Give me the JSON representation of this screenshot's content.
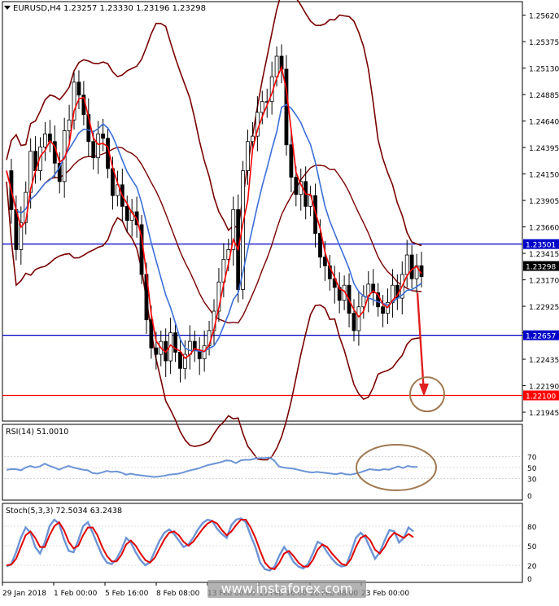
{
  "header": {
    "symbol_tf": "EURUSD,H4",
    "ohlc": "1.23257 1.23330 1.23196 1.23298"
  },
  "watermark": "www.instaforex.com",
  "colors": {
    "candle": "#000000",
    "bollinger": "#7a0000",
    "ma_fast": "#ff0000",
    "ma_slow": "#3a6fd8",
    "hline_blue": "#0000c8",
    "hline_red": "#ff0000",
    "rsi": "#6c94d6",
    "stoch_main": "#6c94d6",
    "stoch_signal": "#e00000",
    "annotation": "#a07850",
    "arrow": "#e02020"
  },
  "chart_data": [
    {
      "type": "candlestick",
      "symbol": "EURUSD",
      "timeframe": "H4",
      "y_ticks": [
        "1.25620",
        "1.25375",
        "1.25130",
        "1.24885",
        "1.24640",
        "1.24395",
        "1.24150",
        "1.23905",
        "1.23660",
        "1.23415",
        "1.23170",
        "1.22925",
        "1.22680",
        "1.22435",
        "1.22190",
        "1.21945"
      ],
      "ylim": [
        1.219,
        1.257
      ],
      "x_tick_labels": [
        "29 Jan 2018",
        "1 Feb 00:00",
        "5 Feb 16:00",
        "8 Feb 08:00",
        "13 Feb 00:00",
        "15 Feb 16:00",
        "20 Feb 08:00",
        "23 Feb 00:00"
      ],
      "horizontal_levels": [
        {
          "value": 1.23501,
          "label": "1.23501",
          "color": "blue"
        },
        {
          "value": 1.22657,
          "label": "1.22657",
          "color": "blue"
        },
        {
          "value": 1.221,
          "label": "1.22100",
          "color": "red"
        }
      ],
      "current_price": {
        "value": 1.23298,
        "label": "1.23298"
      },
      "price_path": [
        1.2418,
        1.2382,
        1.2345,
        1.237,
        1.2398,
        1.2436,
        1.2418,
        1.244,
        1.2452,
        1.2445,
        1.2425,
        1.2408,
        1.2455,
        1.2465,
        1.25,
        1.2488,
        1.247,
        1.2445,
        1.243,
        1.2452,
        1.2448,
        1.242,
        1.2395,
        1.2405,
        1.2385,
        1.2372,
        1.238,
        1.2368,
        1.2322,
        1.228,
        1.2254,
        1.2248,
        1.226,
        1.2242,
        1.2268,
        1.225,
        1.2235,
        1.2248,
        1.226,
        1.2252,
        1.2244,
        1.2256,
        1.227,
        1.2288,
        1.2315,
        1.2336,
        1.2345,
        1.2382,
        1.2308,
        1.2418,
        1.2445,
        1.245,
        1.2472,
        1.2482,
        1.2482,
        1.2505,
        1.2524,
        1.2512,
        1.2442,
        1.2412,
        1.2396,
        1.2408,
        1.2385,
        1.2395,
        1.236,
        1.2338,
        1.233,
        1.2318,
        1.231,
        1.2298,
        1.2312,
        1.2286,
        1.227,
        1.2292,
        1.2302,
        1.2313,
        1.2305,
        1.2292,
        1.2286,
        1.2296,
        1.2312,
        1.23,
        1.2322,
        1.234,
        1.2318,
        1.233,
        1.232
      ],
      "forecast_arrow": {
        "from": 1.2305,
        "to": 1.2212
      }
    },
    {
      "type": "line",
      "title": "RSI(14) 51.0010",
      "y_ticks": [
        "70",
        "50",
        "30",
        "0"
      ],
      "ylim": [
        0,
        100
      ],
      "levels": [
        70,
        50,
        30
      ],
      "values": [
        46,
        47,
        47,
        45,
        50,
        53,
        50,
        52,
        57,
        53,
        50,
        46,
        50,
        53,
        50,
        48,
        46,
        45,
        40,
        39,
        41,
        44,
        42,
        43,
        41,
        37,
        39,
        37,
        36,
        35,
        34,
        33,
        34,
        35,
        37,
        38,
        39,
        41,
        44,
        46,
        48,
        51,
        54,
        56,
        58,
        60,
        63,
        62,
        58,
        63,
        64,
        64,
        66,
        67,
        67,
        68,
        63,
        52,
        50,
        49,
        48,
        46,
        44,
        42,
        41,
        42,
        41,
        40,
        39,
        38,
        40,
        38,
        37,
        39,
        41,
        44,
        47,
        46,
        45,
        47,
        46,
        49,
        52,
        49,
        53,
        51,
        51
      ]
    },
    {
      "type": "line",
      "title": "Stoch(5,3,3) 72.5034 63.2438",
      "y_ticks": [
        "80",
        "50",
        "20",
        "0"
      ],
      "ylim": [
        0,
        100
      ],
      "levels": [
        80,
        50,
        20
      ],
      "series": [
        {
          "values": [
            18,
            22,
            40,
            62,
            78,
            70,
            48,
            38,
            55,
            80,
            90,
            84,
            60,
            42,
            40,
            58,
            80,
            86,
            70,
            52,
            35,
            24,
            22,
            30,
            44,
            62,
            55,
            40,
            28,
            20,
            25,
            42,
            58,
            70,
            75,
            68,
            58,
            48,
            52,
            62,
            75,
            85,
            90,
            88,
            76,
            68,
            62,
            82,
            90,
            92,
            86,
            66,
            48,
            24,
            14,
            12,
            18,
            35,
            48,
            38,
            25,
            18,
            15,
            22,
            38,
            56,
            52,
            40,
            30,
            22,
            18,
            20,
            40,
            62,
            70,
            62,
            46,
            30,
            40,
            58,
            74,
            72,
            55,
            62,
            78,
            72
          ]
        },
        {
          "values": [
            20,
            21,
            30,
            48,
            66,
            72,
            62,
            48,
            48,
            66,
            80,
            86,
            74,
            56,
            46,
            50,
            66,
            78,
            78,
            66,
            48,
            34,
            26,
            26,
            36,
            52,
            58,
            50,
            38,
            28,
            24,
            32,
            46,
            60,
            70,
            72,
            66,
            56,
            50,
            56,
            66,
            76,
            84,
            88,
            84,
            74,
            66,
            72,
            82,
            90,
            90,
            78,
            62,
            42,
            24,
            16,
            14,
            24,
            38,
            42,
            34,
            24,
            18,
            18,
            28,
            44,
            52,
            48,
            38,
            30,
            22,
            20,
            30,
            48,
            62,
            66,
            58,
            44,
            38,
            48,
            62,
            70,
            66,
            62,
            68,
            63
          ]
        }
      ]
    }
  ]
}
